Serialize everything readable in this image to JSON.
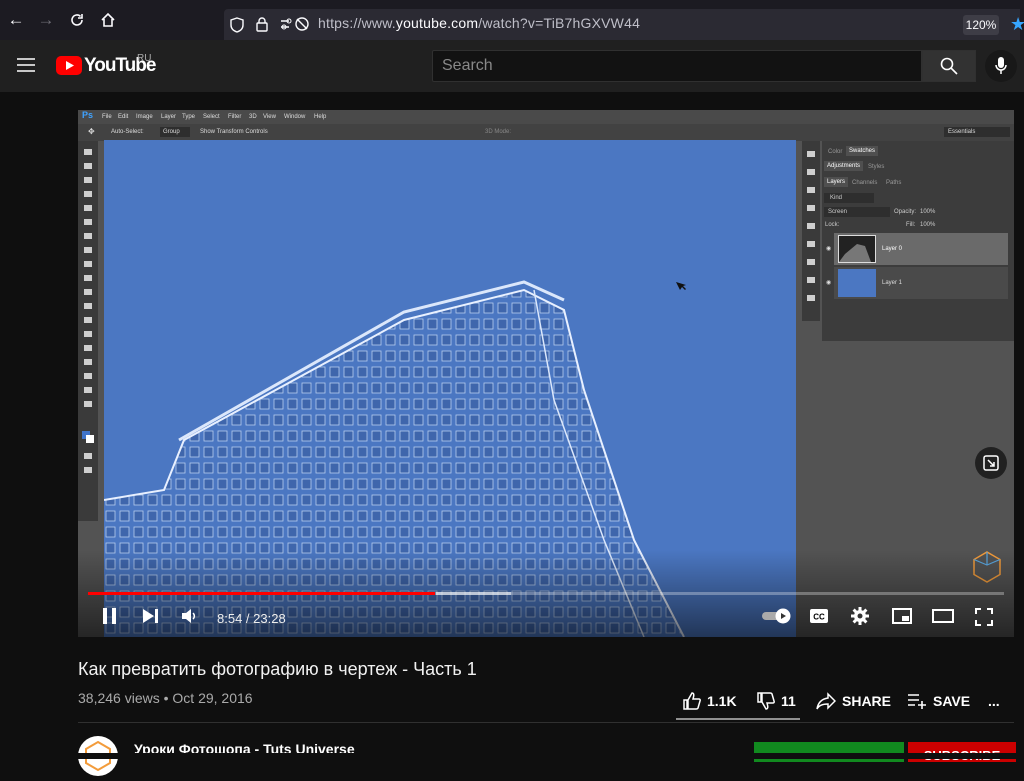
{
  "browser": {
    "url_prefix": "https://www.",
    "url_domain": "youtube.com",
    "url_path": "/watch?v=TiB7hGXVW44",
    "zoom": "120%"
  },
  "youtube": {
    "logo_text": "YouTube",
    "region": "RU",
    "search_placeholder": "Search"
  },
  "photoshop": {
    "app_abbrev": "Ps",
    "menu": [
      "File",
      "Edit",
      "Image",
      "Layer",
      "Type",
      "Select",
      "Filter",
      "3D",
      "View",
      "Window",
      "Help"
    ],
    "options": {
      "auto_select": "Auto-Select:",
      "group": "Group",
      "transform": "Show Transform Controls",
      "mode3d": "3D Mode:",
      "workspace": "Essentials"
    },
    "panel_tabs_1": [
      "Color",
      "Swatches"
    ],
    "panel_tabs_2": [
      "Adjustments",
      "Styles"
    ],
    "panel_tabs_3": [
      "Layers",
      "Channels",
      "Paths"
    ],
    "kind": "Kind",
    "blend_mode": "Screen",
    "opacity_label": "Opacity:",
    "opacity_value": "100%",
    "lock_label": "Lock:",
    "fill_label": "Fill:",
    "fill_value": "100%",
    "layers": [
      "Layer 0",
      "Layer 1"
    ]
  },
  "player": {
    "time": "8:54 / 23:28",
    "progress_fraction": 0.379
  },
  "video": {
    "title": "Как превратить фотографию в чертеж - Часть 1",
    "meta": "38,246 views • Oct 29, 2016",
    "likes": "1.1K",
    "dislikes": "11",
    "share": "SHARE",
    "save": "SAVE",
    "more": "...",
    "channel": "Уроки Фотошопа - Tuts Universe",
    "subscribe": "SUBSCRIBE"
  },
  "colors": {
    "accent": "#ff0000",
    "canvas": "#4b77c2",
    "subscribe": "#cc0000"
  }
}
